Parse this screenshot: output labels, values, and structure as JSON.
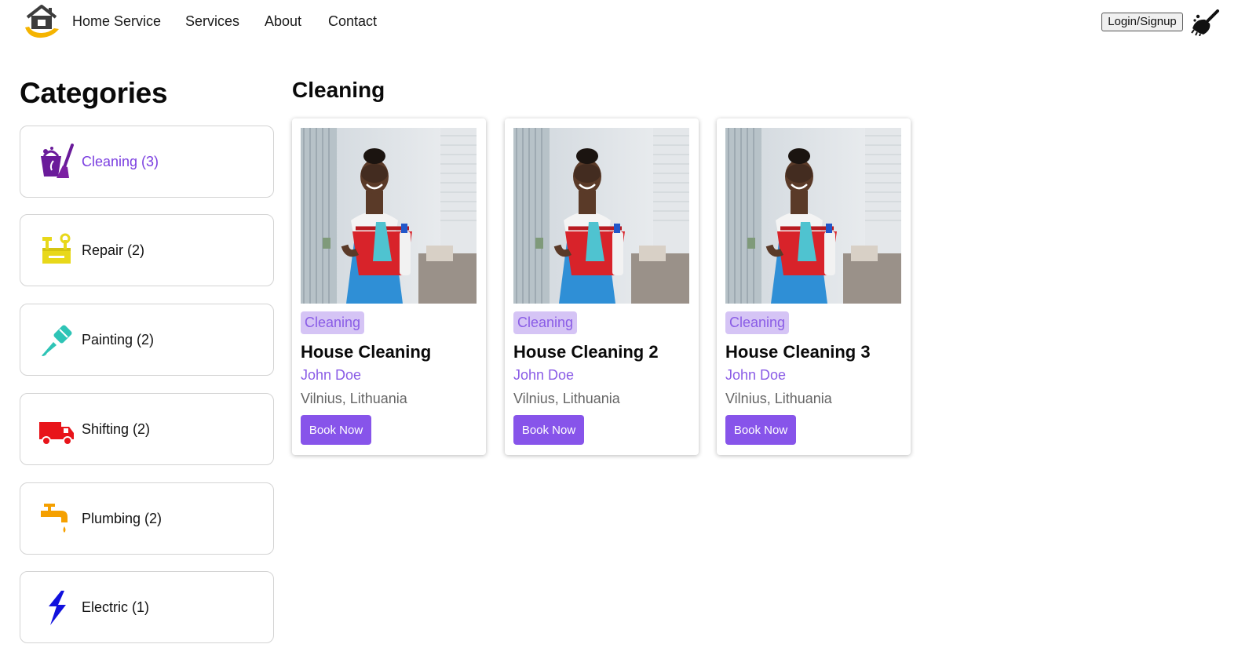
{
  "header": {
    "brand": "Home Service",
    "nav": [
      "Services",
      "About",
      "Contact"
    ],
    "login_label": "Login/Signup",
    "logo_icon": "house-hand-logo-icon",
    "theme_icon": "broom-icon"
  },
  "sidebar": {
    "title": "Categories",
    "items": [
      {
        "label": "Cleaning (3)",
        "icon": "cleaning-bucket-icon",
        "color": "#7b1fa2",
        "active": true
      },
      {
        "label": "Repair (2)",
        "icon": "toolbox-icon",
        "color": "#e8d81a",
        "active": false
      },
      {
        "label": "Painting (2)",
        "icon": "paint-brush-icon",
        "color": "#2ec4b6",
        "active": false
      },
      {
        "label": "Shifting (2)",
        "icon": "truck-icon",
        "color": "#e8141a",
        "active": false
      },
      {
        "label": "Plumbing (2)",
        "icon": "faucet-icon",
        "color": "#f5a000",
        "active": false
      },
      {
        "label": "Electric (1)",
        "icon": "lightning-icon",
        "color": "#1111dd",
        "active": false
      }
    ]
  },
  "main": {
    "title": "Cleaning",
    "cards": [
      {
        "tag": "Cleaning",
        "title": "House Cleaning",
        "provider": "John Doe",
        "location": "Vilnius, Lithuania",
        "button": "Book Now"
      },
      {
        "tag": "Cleaning",
        "title": "House Cleaning 2",
        "provider": "John Doe",
        "location": "Vilnius, Lithuania",
        "button": "Book Now"
      },
      {
        "tag": "Cleaning",
        "title": "House Cleaning 3",
        "provider": "John Doe",
        "location": "Vilnius, Lithuania",
        "button": "Book Now"
      }
    ]
  },
  "colors": {
    "accent": "#8754ea",
    "tag_bg": "#d5c4f5",
    "tag_text": "#8a5ce6"
  }
}
